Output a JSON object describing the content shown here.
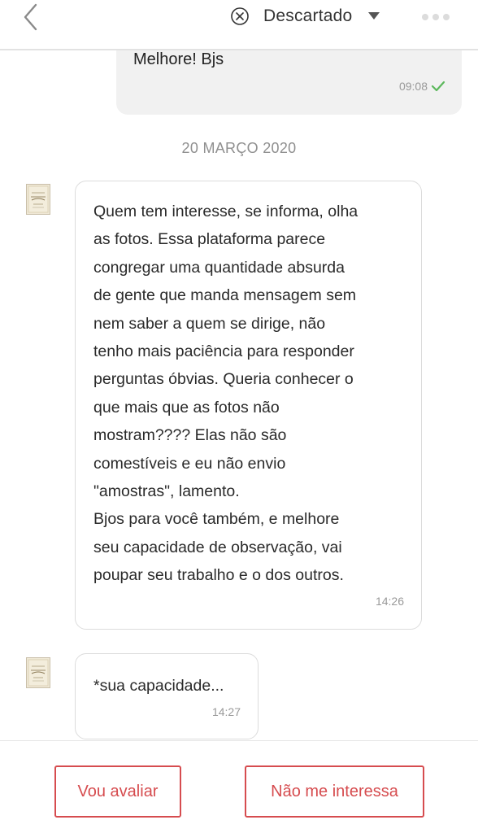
{
  "header": {
    "status_label": "Descartado",
    "back_icon": "chevron-left-icon",
    "status_icon": "circle-x-icon",
    "caret_icon": "caret-down-icon",
    "more_icon": "more-horizontal-icon"
  },
  "messages": {
    "outgoing": {
      "text": "Melhore! Bjs",
      "time": "09:08",
      "status_icon": "check-icon"
    },
    "date_separator": "20 MARÇO 2020",
    "incoming": [
      {
        "text": "Quem tem interesse, se informa, olha\nas fotos. Essa plataforma parece\ncongregar uma quantidade absurda\nde gente que manda mensagem sem\nnem saber a quem se dirige, não\ntenho mais paciência para responder\nperguntas óbvias. Queria conhecer o\nque mais que as fotos não\nmostram???? Elas não são\ncomestíveis e eu não envio\n\"amostras\", lamento.\nBjos para você também, e melhore\nseu capacidade de observação, vai\npoupar seu trabalho e o dos outros.",
        "time": "14:26"
      },
      {
        "text": "*sua capacidade...",
        "time": "14:27"
      }
    ]
  },
  "footer": {
    "evaluate_label": "Vou avaliar",
    "not_interested_label": "Não me interessa"
  },
  "colors": {
    "accent": "#d64c4f",
    "outgoing_bubble": "#f1f1f1",
    "check": "#5cb85c"
  }
}
